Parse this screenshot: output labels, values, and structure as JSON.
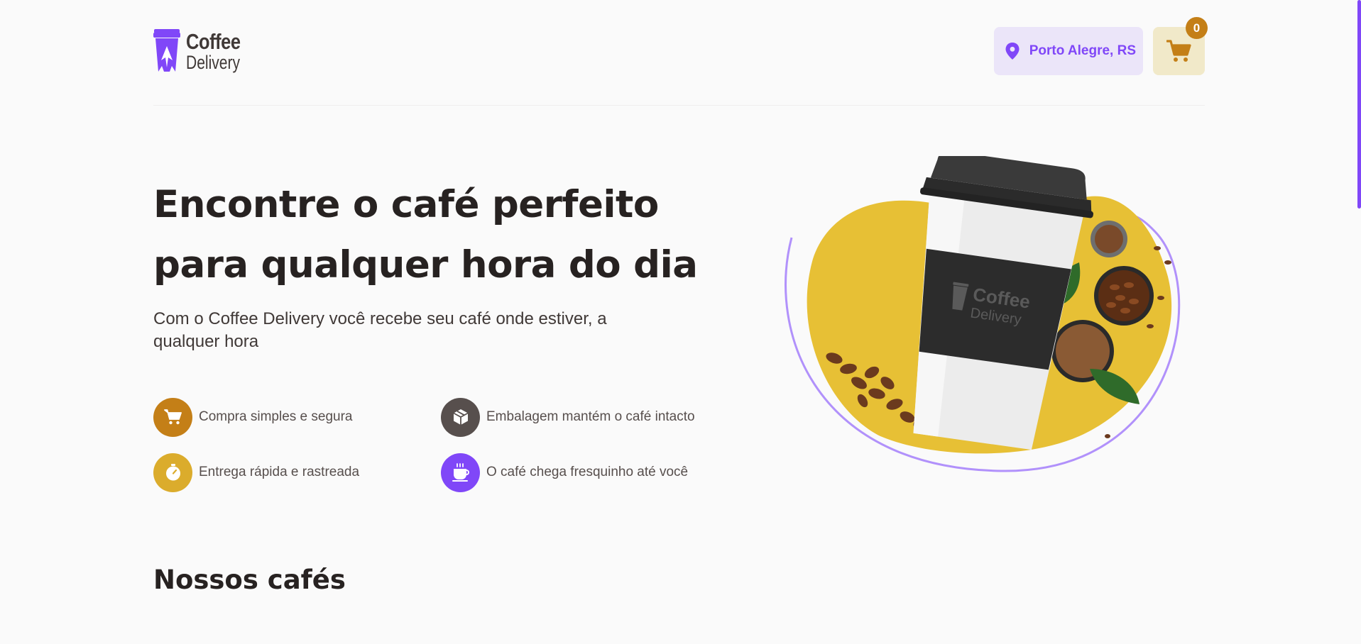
{
  "header": {
    "logo_line1": "Coffee",
    "logo_line2": "Delivery",
    "location": "Porto Alegre, RS",
    "cart_count": "0"
  },
  "hero": {
    "title_line1": "Encontre o café perfeito",
    "title_line2": "para qualquer hora do dia",
    "subtitle": "Com o Coffee Delivery você recebe seu café onde estiver, a qualquer hora",
    "benefits": [
      {
        "label": "Compra simples e segura",
        "icon": "cart-icon",
        "color": "#c47f17"
      },
      {
        "label": "Embalagem mantém o café intacto",
        "icon": "package-icon",
        "color": "#574f4d"
      },
      {
        "label": "Entrega rápida e rastreada",
        "icon": "timer-icon",
        "color": "#dbac2c"
      },
      {
        "label": "O café chega fresquinho até você",
        "icon": "coffee-icon",
        "color": "#8047f8"
      }
    ],
    "illustration_cup_logo_line1": "Coffee",
    "illustration_cup_logo_line2": "Delivery"
  },
  "section": {
    "title": "Nossos cafés"
  },
  "colors": {
    "purple": "#8047f8",
    "purple_light": "#ebe5f9",
    "yellow_dark": "#c47f17",
    "yellow": "#dbac2c",
    "yellow_light": "#f1e9c9",
    "background": "#fafafa",
    "title": "#272221"
  }
}
